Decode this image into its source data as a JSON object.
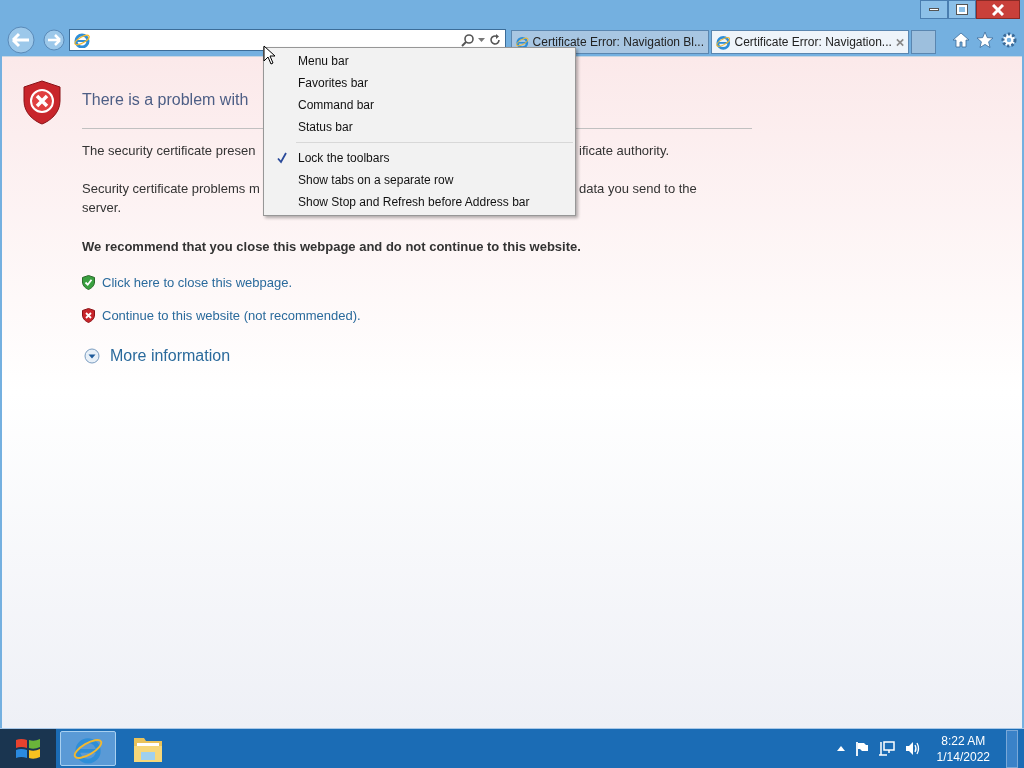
{
  "tabs": [
    {
      "title": "Certificate Error: Navigation Bl...",
      "selected": false
    },
    {
      "title": "Certificate Error: Navigation...",
      "selected": true
    }
  ],
  "page": {
    "heading": "There is a problem with",
    "paragraphs": [
      {
        "lines": [
          [
            "The security certificate presen",
            "ificate authority."
          ]
        ]
      },
      {
        "lines": [
          [
            "Security certificate problems m",
            "data you send to the"
          ],
          [
            "server."
          ]
        ]
      }
    ],
    "recommendation": "We recommend that you close this webpage and do not continue to this website.",
    "links": [
      {
        "kind": "safe",
        "text": "Click here to close this webpage."
      },
      {
        "kind": "unsafe",
        "text": "Continue to this website (not recommended)."
      }
    ],
    "more": "More information"
  },
  "context_menu": {
    "sections": [
      [
        {
          "label": "Menu bar",
          "checked": false
        },
        {
          "label": "Favorites bar",
          "checked": false
        },
        {
          "label": "Command bar",
          "checked": false
        },
        {
          "label": "Status bar",
          "checked": false
        }
      ],
      [
        {
          "label": "Lock the toolbars",
          "checked": true
        },
        {
          "label": "Show tabs on a separate row",
          "checked": false
        },
        {
          "label": "Show Stop and Refresh before Address bar",
          "checked": false
        }
      ]
    ]
  },
  "taskbar": {
    "apps": [
      {
        "kind": "ie",
        "selected": true
      },
      {
        "kind": "folder",
        "selected": false
      }
    ],
    "time": "8:22 AM",
    "date": "1/14/2022"
  }
}
